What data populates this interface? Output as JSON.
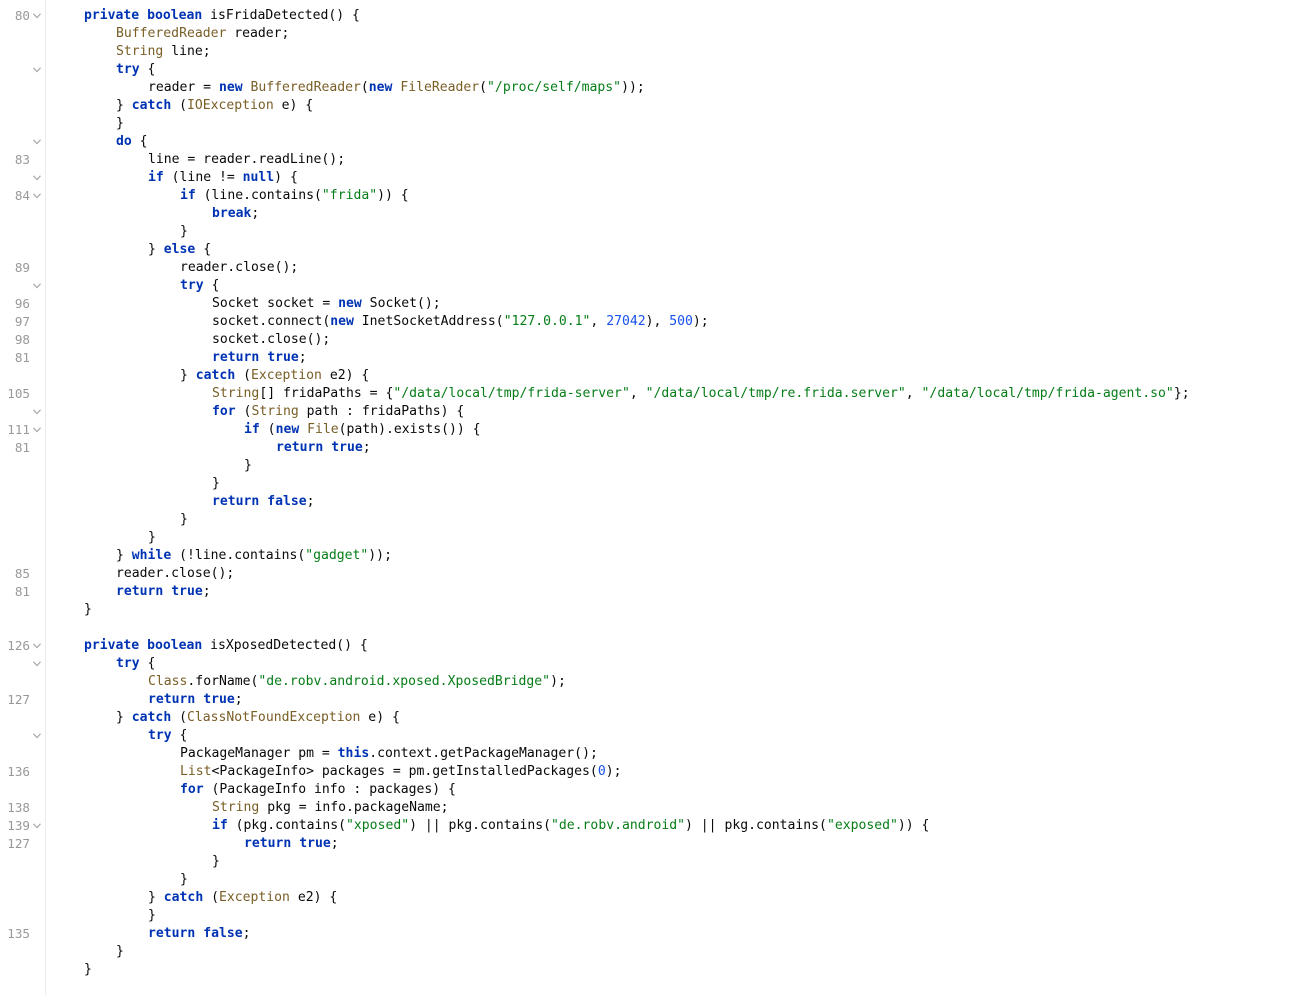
{
  "editor": {
    "colors": {
      "keyword": "#0033b3",
      "type": "#795e26",
      "string": "#067d17",
      "number": "#1750eb",
      "text": "#080808",
      "line_number": "#999999",
      "background": "#ffffff"
    },
    "lines": [
      {
        "ln": "80",
        "fold": true,
        "indent": 1,
        "tokens": [
          [
            "kw",
            "private"
          ],
          [
            "p",
            " "
          ],
          [
            "kw",
            "boolean"
          ],
          [
            "p",
            " isFridaDetected() {"
          ]
        ]
      },
      {
        "ln": "",
        "fold": false,
        "indent": 2,
        "tokens": [
          [
            "t",
            "BufferedReader"
          ],
          [
            "p",
            " reader;"
          ]
        ]
      },
      {
        "ln": "",
        "fold": false,
        "indent": 2,
        "tokens": [
          [
            "t",
            "String"
          ],
          [
            "p",
            " line;"
          ]
        ]
      },
      {
        "ln": "",
        "fold": true,
        "indent": 2,
        "tokens": [
          [
            "kw",
            "try"
          ],
          [
            "p",
            " {"
          ]
        ]
      },
      {
        "ln": "",
        "fold": false,
        "indent": 3,
        "tokens": [
          [
            "p",
            "reader = "
          ],
          [
            "kw",
            "new"
          ],
          [
            "p",
            " "
          ],
          [
            "t",
            "BufferedReader"
          ],
          [
            "p",
            "("
          ],
          [
            "kw",
            "new"
          ],
          [
            "p",
            " "
          ],
          [
            "t",
            "FileReader"
          ],
          [
            "p",
            "("
          ],
          [
            "s",
            "\"/proc/self/maps\""
          ],
          [
            "p",
            "));"
          ]
        ]
      },
      {
        "ln": "",
        "fold": false,
        "indent": 2,
        "tokens": [
          [
            "p",
            "} "
          ],
          [
            "kw",
            "catch"
          ],
          [
            "p",
            " ("
          ],
          [
            "t",
            "IOException"
          ],
          [
            "p",
            " e) {"
          ]
        ]
      },
      {
        "ln": "",
        "fold": false,
        "indent": 2,
        "tokens": [
          [
            "p",
            "}"
          ]
        ]
      },
      {
        "ln": "",
        "fold": true,
        "indent": 2,
        "tokens": [
          [
            "kw",
            "do"
          ],
          [
            "p",
            " {"
          ]
        ]
      },
      {
        "ln": "83",
        "fold": false,
        "indent": 3,
        "tokens": [
          [
            "p",
            "line = reader.readLine();"
          ]
        ]
      },
      {
        "ln": "",
        "fold": true,
        "indent": 3,
        "tokens": [
          [
            "kw",
            "if"
          ],
          [
            "p",
            " (line != "
          ],
          [
            "kw",
            "null"
          ],
          [
            "p",
            ") {"
          ]
        ]
      },
      {
        "ln": "84",
        "fold": true,
        "indent": 4,
        "tokens": [
          [
            "kw",
            "if"
          ],
          [
            "p",
            " (line.contains("
          ],
          [
            "s",
            "\"frida\""
          ],
          [
            "p",
            ")) {"
          ]
        ]
      },
      {
        "ln": "",
        "fold": false,
        "indent": 5,
        "tokens": [
          [
            "kw",
            "break"
          ],
          [
            "p",
            ";"
          ]
        ]
      },
      {
        "ln": "",
        "fold": false,
        "indent": 4,
        "tokens": [
          [
            "p",
            "}"
          ]
        ]
      },
      {
        "ln": "",
        "fold": false,
        "indent": 3,
        "tokens": [
          [
            "p",
            "} "
          ],
          [
            "kw",
            "else"
          ],
          [
            "p",
            " {"
          ]
        ]
      },
      {
        "ln": "89",
        "fold": false,
        "indent": 4,
        "tokens": [
          [
            "p",
            "reader.close();"
          ]
        ]
      },
      {
        "ln": "",
        "fold": true,
        "indent": 4,
        "tokens": [
          [
            "kw",
            "try"
          ],
          [
            "p",
            " {"
          ]
        ]
      },
      {
        "ln": "96",
        "fold": false,
        "indent": 5,
        "tokens": [
          [
            "p",
            "Socket socket = "
          ],
          [
            "kw",
            "new"
          ],
          [
            "p",
            " Socket();"
          ]
        ]
      },
      {
        "ln": "97",
        "fold": false,
        "indent": 5,
        "tokens": [
          [
            "p",
            "socket.connect("
          ],
          [
            "kw",
            "new"
          ],
          [
            "p",
            " InetSocketAddress("
          ],
          [
            "s",
            "\"127.0.0.1\""
          ],
          [
            "p",
            ", "
          ],
          [
            "n",
            "27042"
          ],
          [
            "p",
            "), "
          ],
          [
            "n",
            "500"
          ],
          [
            "p",
            ");"
          ]
        ]
      },
      {
        "ln": "98",
        "fold": false,
        "indent": 5,
        "tokens": [
          [
            "p",
            "socket.close();"
          ]
        ]
      },
      {
        "ln": "81",
        "fold": false,
        "indent": 5,
        "tokens": [
          [
            "kw",
            "return"
          ],
          [
            "p",
            " "
          ],
          [
            "kw",
            "true"
          ],
          [
            "p",
            ";"
          ]
        ]
      },
      {
        "ln": "",
        "fold": false,
        "indent": 4,
        "tokens": [
          [
            "p",
            "} "
          ],
          [
            "kw",
            "catch"
          ],
          [
            "p",
            " ("
          ],
          [
            "t",
            "Exception"
          ],
          [
            "p",
            " e2) {"
          ]
        ]
      },
      {
        "ln": "105",
        "fold": false,
        "indent": 5,
        "tokens": [
          [
            "t",
            "String"
          ],
          [
            "p",
            "[] fridaPaths = {"
          ],
          [
            "s",
            "\"/data/local/tmp/frida-server\""
          ],
          [
            "p",
            ", "
          ],
          [
            "s",
            "\"/data/local/tmp/re.frida.server\""
          ],
          [
            "p",
            ", "
          ],
          [
            "s",
            "\"/data/local/tmp/frida-agent.so\""
          ],
          [
            "p",
            "};"
          ]
        ]
      },
      {
        "ln": "",
        "fold": true,
        "indent": 5,
        "tokens": [
          [
            "kw",
            "for"
          ],
          [
            "p",
            " ("
          ],
          [
            "t",
            "String"
          ],
          [
            "p",
            " path : fridaPaths) {"
          ]
        ]
      },
      {
        "ln": "111",
        "fold": true,
        "indent": 6,
        "tokens": [
          [
            "kw",
            "if"
          ],
          [
            "p",
            " ("
          ],
          [
            "kw",
            "new"
          ],
          [
            "p",
            " "
          ],
          [
            "t",
            "File"
          ],
          [
            "p",
            "(path).exists()) {"
          ]
        ]
      },
      {
        "ln": "81",
        "fold": false,
        "indent": 7,
        "tokens": [
          [
            "kw",
            "return"
          ],
          [
            "p",
            " "
          ],
          [
            "kw",
            "true"
          ],
          [
            "p",
            ";"
          ]
        ]
      },
      {
        "ln": "",
        "fold": false,
        "indent": 6,
        "tokens": [
          [
            "p",
            "}"
          ]
        ]
      },
      {
        "ln": "",
        "fold": false,
        "indent": 5,
        "tokens": [
          [
            "p",
            "}"
          ]
        ]
      },
      {
        "ln": "",
        "fold": false,
        "indent": 5,
        "tokens": [
          [
            "kw",
            "return"
          ],
          [
            "p",
            " "
          ],
          [
            "kw",
            "false"
          ],
          [
            "p",
            ";"
          ]
        ]
      },
      {
        "ln": "",
        "fold": false,
        "indent": 4,
        "tokens": [
          [
            "p",
            "}"
          ]
        ]
      },
      {
        "ln": "",
        "fold": false,
        "indent": 3,
        "tokens": [
          [
            "p",
            "}"
          ]
        ]
      },
      {
        "ln": "",
        "fold": false,
        "indent": 2,
        "tokens": [
          [
            "p",
            "} "
          ],
          [
            "kw",
            "while"
          ],
          [
            "p",
            " (!line.contains("
          ],
          [
            "s",
            "\"gadget\""
          ],
          [
            "p",
            "));"
          ]
        ]
      },
      {
        "ln": "85",
        "fold": false,
        "indent": 2,
        "tokens": [
          [
            "p",
            "reader.close();"
          ]
        ]
      },
      {
        "ln": "81",
        "fold": false,
        "indent": 2,
        "tokens": [
          [
            "kw",
            "return"
          ],
          [
            "p",
            " "
          ],
          [
            "kw",
            "true"
          ],
          [
            "p",
            ";"
          ]
        ]
      },
      {
        "ln": "",
        "fold": false,
        "indent": 1,
        "tokens": [
          [
            "p",
            "}"
          ]
        ]
      },
      {
        "ln": "",
        "fold": false,
        "indent": 0,
        "tokens": []
      },
      {
        "ln": "126",
        "fold": true,
        "indent": 1,
        "tokens": [
          [
            "kw",
            "private"
          ],
          [
            "p",
            " "
          ],
          [
            "kw",
            "boolean"
          ],
          [
            "p",
            " isXposedDetected() {"
          ]
        ]
      },
      {
        "ln": "",
        "fold": true,
        "indent": 2,
        "tokens": [
          [
            "kw",
            "try"
          ],
          [
            "p",
            " {"
          ]
        ]
      },
      {
        "ln": "",
        "fold": false,
        "indent": 3,
        "tokens": [
          [
            "t",
            "Class"
          ],
          [
            "p",
            ".forName("
          ],
          [
            "s",
            "\"de.robv.android.xposed.XposedBridge\""
          ],
          [
            "p",
            ");"
          ]
        ]
      },
      {
        "ln": "127",
        "fold": false,
        "indent": 3,
        "tokens": [
          [
            "kw",
            "return"
          ],
          [
            "p",
            " "
          ],
          [
            "kw",
            "true"
          ],
          [
            "p",
            ";"
          ]
        ]
      },
      {
        "ln": "",
        "fold": false,
        "indent": 2,
        "tokens": [
          [
            "p",
            "} "
          ],
          [
            "kw",
            "catch"
          ],
          [
            "p",
            " ("
          ],
          [
            "t",
            "ClassNotFoundException"
          ],
          [
            "p",
            " e) {"
          ]
        ]
      },
      {
        "ln": "",
        "fold": true,
        "indent": 3,
        "tokens": [
          [
            "kw",
            "try"
          ],
          [
            "p",
            " {"
          ]
        ]
      },
      {
        "ln": "",
        "fold": false,
        "indent": 4,
        "tokens": [
          [
            "p",
            "PackageManager pm = "
          ],
          [
            "kw",
            "this"
          ],
          [
            "p",
            ".context.getPackageManager();"
          ]
        ]
      },
      {
        "ln": "136",
        "fold": false,
        "indent": 4,
        "tokens": [
          [
            "t",
            "List"
          ],
          [
            "p",
            "<PackageInfo> packages = pm.getInstalledPackages("
          ],
          [
            "n",
            "0"
          ],
          [
            "p",
            ");"
          ]
        ]
      },
      {
        "ln": "",
        "fold": false,
        "indent": 4,
        "tokens": [
          [
            "kw",
            "for"
          ],
          [
            "p",
            " (PackageInfo info : packages) {"
          ]
        ]
      },
      {
        "ln": "138",
        "fold": false,
        "indent": 5,
        "tokens": [
          [
            "t",
            "String"
          ],
          [
            "p",
            " pkg = info.packageName;"
          ]
        ]
      },
      {
        "ln": "139",
        "fold": true,
        "indent": 5,
        "tokens": [
          [
            "kw",
            "if"
          ],
          [
            "p",
            " (pkg.contains("
          ],
          [
            "s",
            "\"xposed\""
          ],
          [
            "p",
            ") || pkg.contains("
          ],
          [
            "s",
            "\"de.robv.android\""
          ],
          [
            "p",
            ") || pkg.contains("
          ],
          [
            "s",
            "\"exposed\""
          ],
          [
            "p",
            ")) {"
          ]
        ]
      },
      {
        "ln": "127",
        "fold": false,
        "indent": 6,
        "tokens": [
          [
            "kw",
            "return"
          ],
          [
            "p",
            " "
          ],
          [
            "kw",
            "true"
          ],
          [
            "p",
            ";"
          ]
        ]
      },
      {
        "ln": "",
        "fold": false,
        "indent": 5,
        "tokens": [
          [
            "p",
            "}"
          ]
        ]
      },
      {
        "ln": "",
        "fold": false,
        "indent": 4,
        "tokens": [
          [
            "p",
            "}"
          ]
        ]
      },
      {
        "ln": "",
        "fold": false,
        "indent": 3,
        "tokens": [
          [
            "p",
            "} "
          ],
          [
            "kw",
            "catch"
          ],
          [
            "p",
            " ("
          ],
          [
            "t",
            "Exception"
          ],
          [
            "p",
            " e2) {"
          ]
        ]
      },
      {
        "ln": "",
        "fold": false,
        "indent": 3,
        "tokens": [
          [
            "p",
            "}"
          ]
        ]
      },
      {
        "ln": "135",
        "fold": false,
        "indent": 3,
        "tokens": [
          [
            "kw",
            "return"
          ],
          [
            "p",
            " "
          ],
          [
            "kw",
            "false"
          ],
          [
            "p",
            ";"
          ]
        ]
      },
      {
        "ln": "",
        "fold": false,
        "indent": 2,
        "tokens": [
          [
            "p",
            "}"
          ]
        ]
      },
      {
        "ln": "",
        "fold": false,
        "indent": 1,
        "tokens": [
          [
            "p",
            "}"
          ]
        ]
      }
    ]
  }
}
